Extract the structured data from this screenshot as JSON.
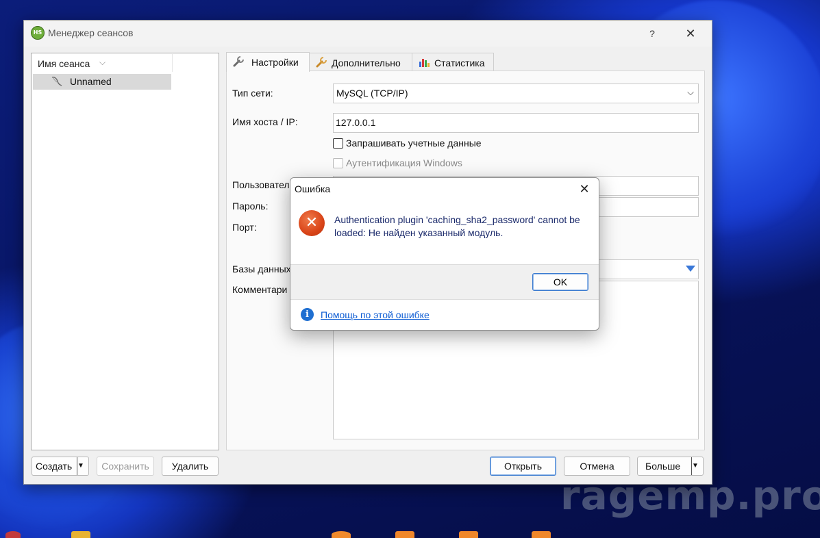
{
  "watermark": "ragemp.pro",
  "window": {
    "title": "Менеджер сеансов",
    "help_label": "?",
    "close_label": "✕"
  },
  "sessions": {
    "header": "Имя сеанса",
    "items": [
      {
        "label": "Unnamed"
      }
    ]
  },
  "tabs": [
    {
      "label": "Настройки",
      "active": true
    },
    {
      "label": "Дополнительно",
      "active": false
    },
    {
      "label": "Статистика",
      "active": false
    }
  ],
  "settings": {
    "network_type_label": "Тип сети:",
    "network_type_value": "MySQL (TCP/IP)",
    "host_label": "Имя хоста / IP:",
    "host_value": "127.0.0.1",
    "prompt_credentials_label": "Запрашивать учетные данные",
    "windows_auth_label": "Аутентификация Windows",
    "user_label": "Пользовател",
    "password_label": "Пароль:",
    "port_label": "Порт:",
    "databases_label": "Базы данных",
    "comment_label": "Комментари"
  },
  "buttons": {
    "create": "Создать",
    "save": "Сохранить",
    "delete": "Удалить",
    "open": "Открыть",
    "cancel": "Отмена",
    "more": "Больше"
  },
  "error_dialog": {
    "title": "Ошибка",
    "message": "Authentication plugin 'caching_sha2_password' cannot be loaded: Не найден указанный модуль.",
    "ok": "OK",
    "help_link": "Помощь по этой ошибке",
    "close_label": "✕"
  },
  "colors": {
    "error_icon": "#d94418",
    "link": "#0b5bd3",
    "selection": "#d9d9d9",
    "accent_border": "#3b7bd0"
  }
}
